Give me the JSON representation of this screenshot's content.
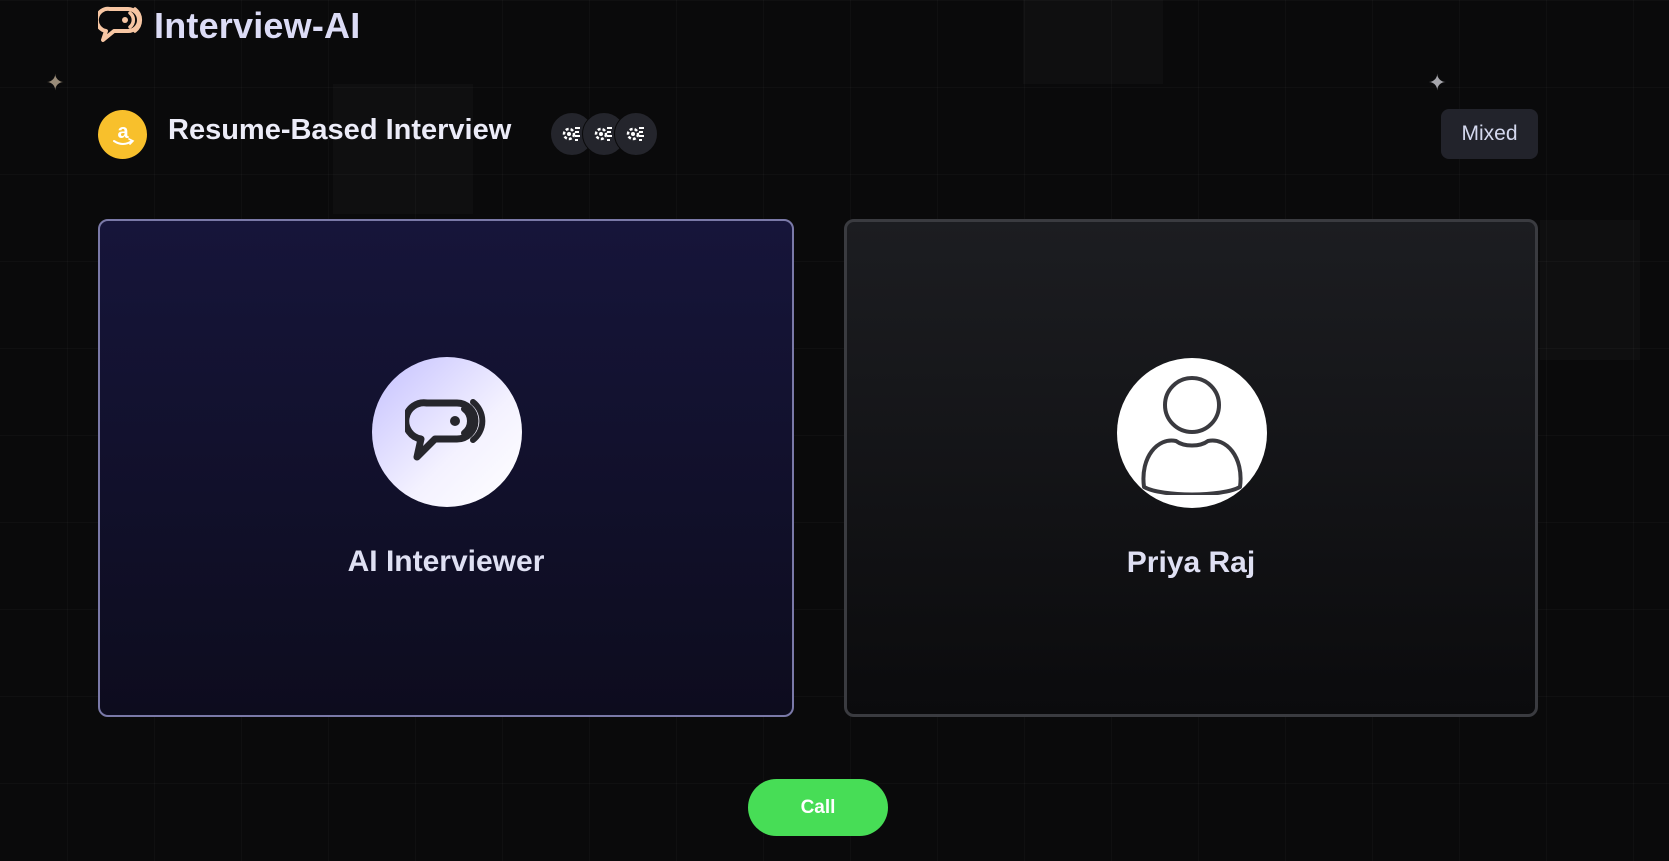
{
  "app": {
    "title": "Interview-AI",
    "logo_icon": "chat-voice-icon"
  },
  "interview": {
    "title": "Resume-Based Interview",
    "company_icon": "amazon-logo",
    "tech_icons": [
      "tech-stack-icon",
      "tech-stack-icon",
      "tech-stack-icon"
    ],
    "type": "Mixed"
  },
  "participants": {
    "ai": {
      "name": "AI Interviewer",
      "icon": "chat-voice-icon"
    },
    "user": {
      "name": "Priya Raj",
      "icon": "user-avatar-icon"
    }
  },
  "actions": {
    "call_label": "Call",
    "call_color": "#47dd56"
  },
  "colors": {
    "background": "#0a0a0b",
    "brand_accent": "#f7c6a3",
    "company_logo": "#f8c02c"
  }
}
